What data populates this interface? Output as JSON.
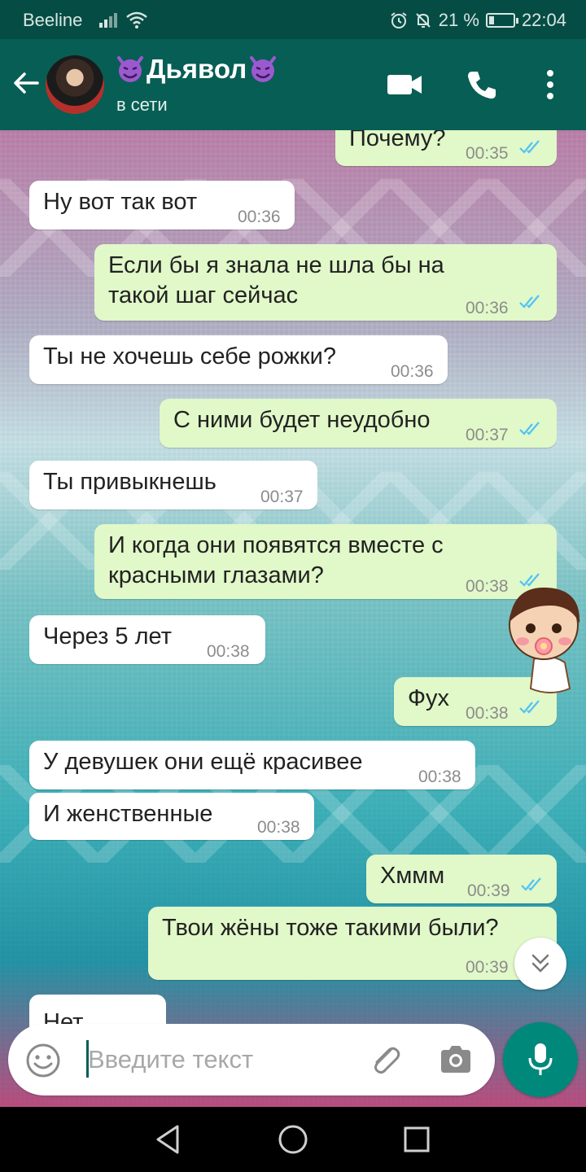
{
  "status_bar": {
    "carrier": "Beeline",
    "battery": "21 %",
    "battery_level": 0.21,
    "time": "22:04"
  },
  "header": {
    "contact_name": "Дьявол",
    "status": "в сети",
    "icons": [
      "back-arrow-icon",
      "devil-emoji-icon",
      "video-call-icon",
      "phone-icon",
      "more-vert-icon"
    ]
  },
  "messages": [
    {
      "side": "out",
      "lines": [
        "Почему?"
      ],
      "time": "00:35"
    },
    {
      "side": "in",
      "lines": [
        "Ну вот так вот"
      ],
      "time": "00:36"
    },
    {
      "side": "out",
      "lines": [
        "Если бы я знала не шла бы на",
        "такой шаг сейчас"
      ],
      "time": "00:36"
    },
    {
      "side": "in",
      "lines": [
        "Ты не хочешь себе рожки?"
      ],
      "time": "00:36"
    },
    {
      "side": "out",
      "lines": [
        "С ними будет неудобно"
      ],
      "time": "00:37"
    },
    {
      "side": "in",
      "lines": [
        "Ты привыкнешь"
      ],
      "time": "00:37"
    },
    {
      "side": "out",
      "lines": [
        "И когда они появятся вместе с",
        "красными глазами?"
      ],
      "time": "00:38"
    },
    {
      "side": "in",
      "lines": [
        "Через 5 лет"
      ],
      "time": "00:38"
    },
    {
      "side": "out",
      "lines": [
        "Фух"
      ],
      "time": "00:38"
    },
    {
      "side": "in",
      "lines": [
        "У девушек они ещё красивее"
      ],
      "time": "00:38"
    },
    {
      "side": "in",
      "lines": [
        "И женственные"
      ],
      "time": "00:38"
    },
    {
      "side": "out",
      "lines": [
        "Хммм"
      ],
      "time": "00:39"
    },
    {
      "side": "out",
      "lines": [
        "Твои жёны тоже такими были?"
      ],
      "time": "00:39"
    },
    {
      "side": "in",
      "lines": [
        "Нет"
      ],
      "time": ""
    }
  ],
  "input": {
    "placeholder": "Введите текст",
    "value": ""
  },
  "colors": {
    "header": "#075e54",
    "status_bar": "#054d44",
    "outgoing_bubble": "#e1f8c9",
    "incoming_bubble": "#ffffff",
    "read_ticks": "#4fc3f7",
    "mic_button": "#00897b"
  }
}
